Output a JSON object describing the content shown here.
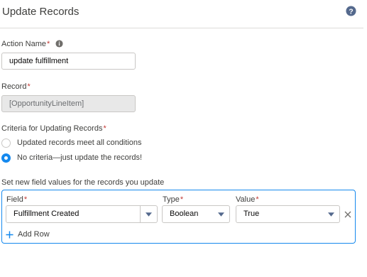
{
  "panel": {
    "title": "Update Records",
    "help_icon": "question-circle-icon"
  },
  "action_name": {
    "label": "Action Name",
    "required_mark": "*",
    "info_icon": "info-icon",
    "value": "update fulfillment"
  },
  "record": {
    "label": "Record",
    "required_mark": "*",
    "value": "[OpportunityLineItem]"
  },
  "criteria": {
    "label": "Criteria for Updating Records",
    "required_mark": "*",
    "options": [
      {
        "label": "Updated records meet all conditions",
        "selected": false
      },
      {
        "label": "No criteria—just update the records!",
        "selected": true
      }
    ]
  },
  "field_values": {
    "section_label": "Set new field values for the records you update",
    "columns": {
      "field": "Field",
      "type": "Type",
      "value": "Value",
      "required_mark": "*"
    },
    "rows": [
      {
        "field": "Fulfillment Created",
        "type": "Boolean",
        "value": "True"
      }
    ],
    "add_row_label": "Add Row"
  },
  "colors": {
    "accent": "#1589ee",
    "required": "#c23934"
  }
}
